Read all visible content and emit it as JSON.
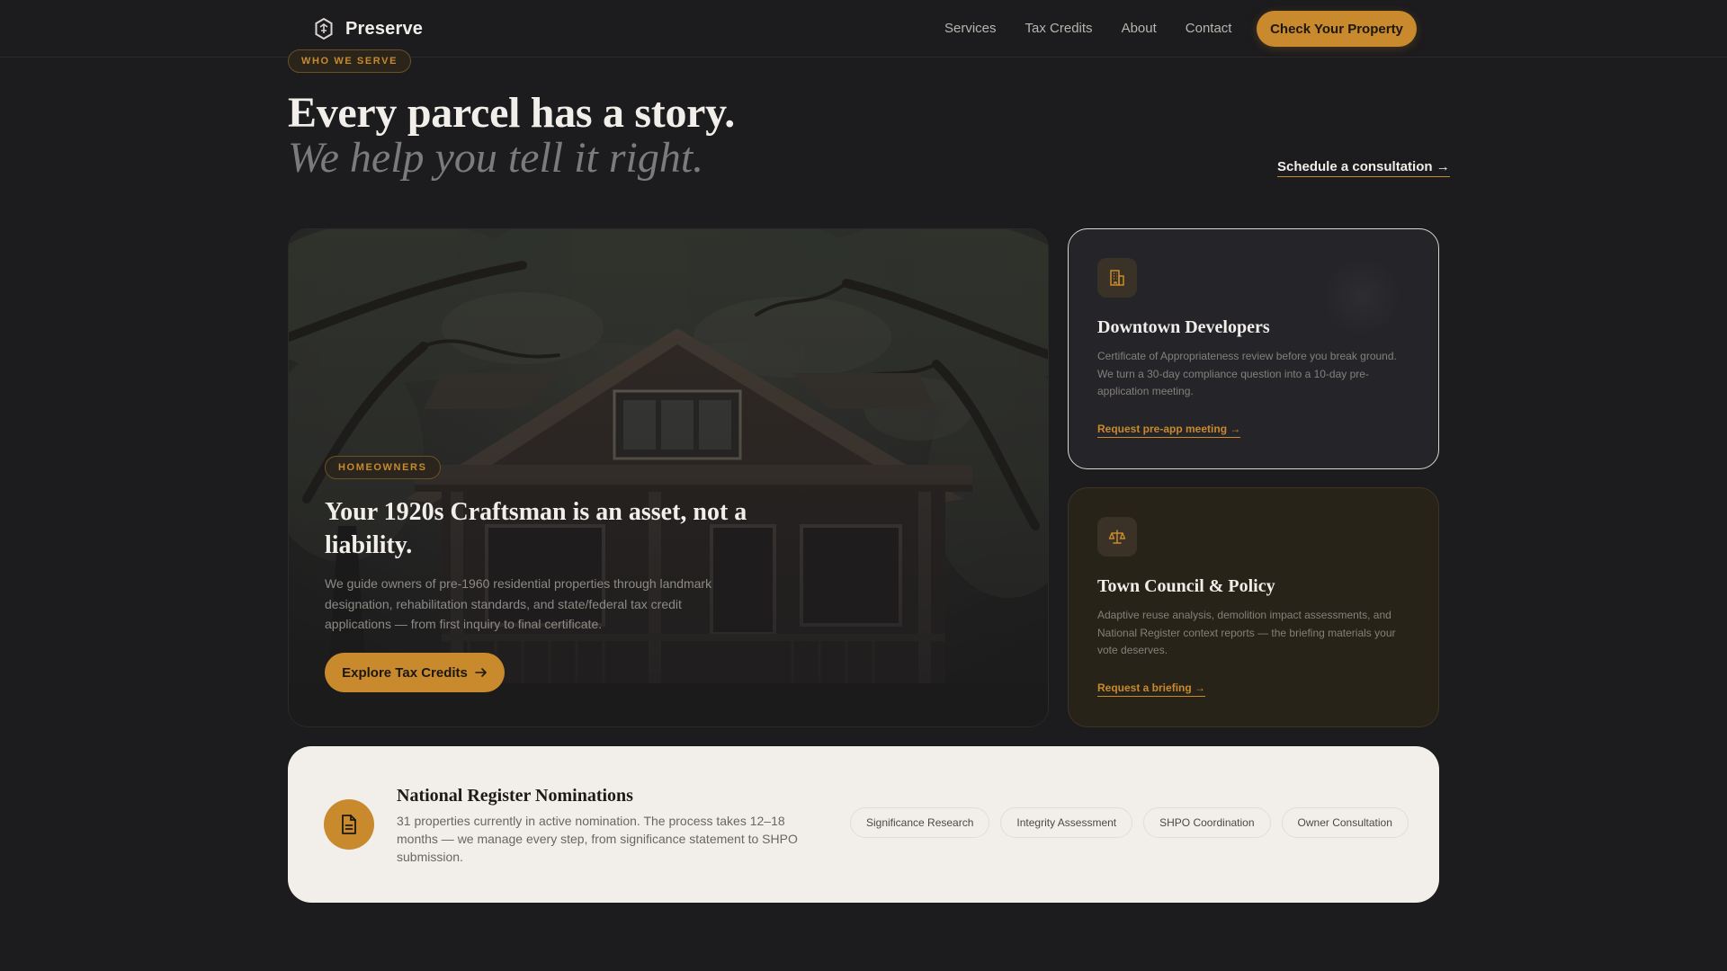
{
  "nav": {
    "brand": "Preserve",
    "links": [
      "Services",
      "Tax Credits",
      "About",
      "Contact"
    ],
    "cta": "Check Your Property"
  },
  "header": {
    "eyebrow": "WHO WE SERVE",
    "headline": "Every parcel has a story.",
    "subheadline": "We help you tell it right.",
    "consult_link": "Schedule a consultation →"
  },
  "hero": {
    "badge": "HOMEOWNERS",
    "title": "Your 1920s Craftsman is an asset, not a liability.",
    "description": "We guide owners of pre-1960 residential properties through landmark designation, rehabilitation standards, and state/federal tax credit applications — from first inquiry to final certificate.",
    "button": "Explore Tax Credits",
    "image_subject": "craftsman-house-under-oak-trees"
  },
  "cards": [
    {
      "icon": "building-icon",
      "title": "Downtown Developers",
      "description": "Certificate of Appropriateness review before you break ground. We turn a 30-day compliance question into a 10-day pre-application meeting.",
      "link": "Request pre-app meeting →"
    },
    {
      "icon": "scales-icon",
      "title": "Town Council & Policy",
      "description": "Adaptive reuse analysis, demolition impact assessments, and National Register context reports — the briefing materials your vote deserves.",
      "link": "Request a briefing →"
    }
  ],
  "strip": {
    "icon": "document-icon",
    "title": "National Register Nominations",
    "description": "31 properties currently in active nomination. The process takes 12–18 months — we manage every step, from significance statement to SHPO submission.",
    "tags": [
      "Significance Research",
      "Integrity Assessment",
      "SHPO Coordination",
      "Owner Consultation"
    ]
  },
  "colors": {
    "background": "#1c1b1d",
    "accent": "#c88a2c",
    "light_panel": "#f2efea"
  }
}
